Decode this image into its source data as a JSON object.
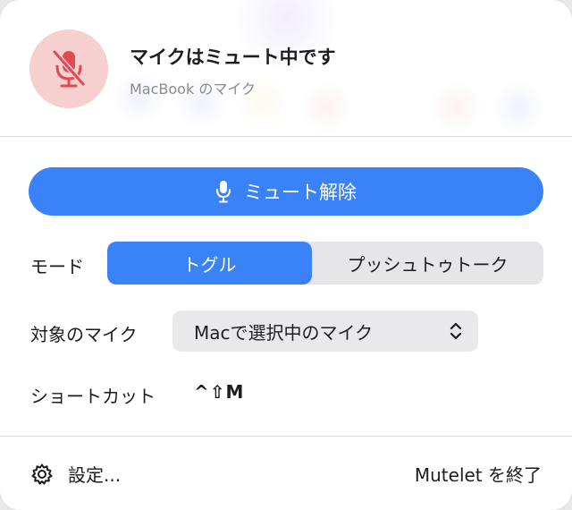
{
  "header": {
    "title": "マイクはミュート中です",
    "subtitle": "MacBook のマイク"
  },
  "unmute_button": {
    "label": "ミュート解除"
  },
  "mode": {
    "label": "モード",
    "options": [
      "トグル",
      "プッシュトゥトーク"
    ],
    "selected": "トグル"
  },
  "target_mic": {
    "label": "対象のマイク",
    "value": "Macで選択中のマイク"
  },
  "shortcut": {
    "label": "ショートカット",
    "keys": "^⇧M"
  },
  "footer": {
    "settings_label": "設定...",
    "quit_label": "Mutelet を終了"
  },
  "colors": {
    "accent": "#3a82f7",
    "muted_badge_bg": "#f6cfcf",
    "muted_icon": "#e04b52"
  }
}
